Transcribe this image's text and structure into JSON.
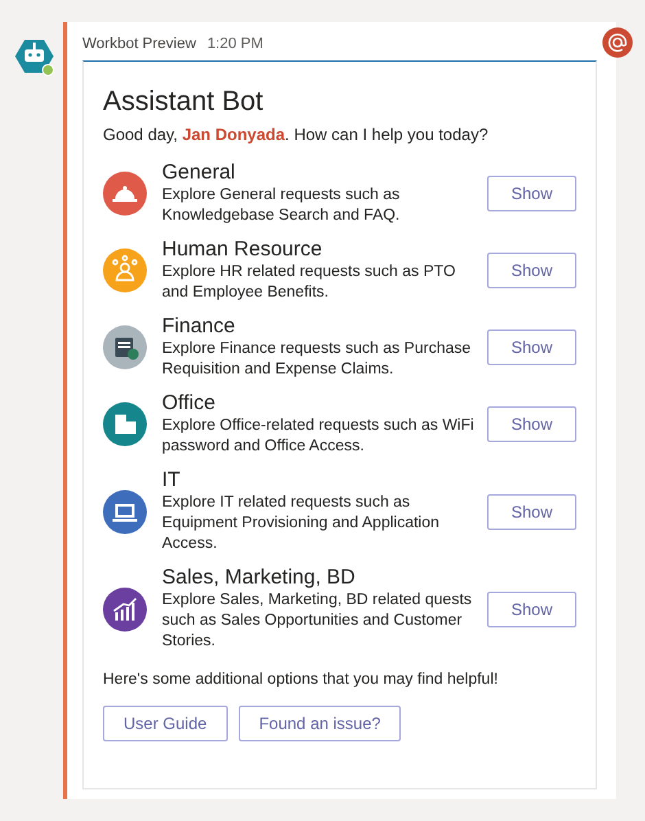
{
  "message": {
    "sender": "Workbot Preview",
    "time": "1:20 PM"
  },
  "card": {
    "title": "Assistant Bot",
    "greeting": "Good day, **Jan Donyada**. How can I help you today?",
    "categories": [
      {
        "title": "General",
        "description": "Explore General requests such as Knowledgebase Search and FAQ.",
        "color": "#e05a4a",
        "button": "Show"
      },
      {
        "title": "Human Resource",
        "description": "Explore HR related requests such as PTO and Employee Benefits.",
        "color": "#f7a21b",
        "button": "Show"
      },
      {
        "title": "Finance",
        "description": "Explore Finance requests such as Purchase Requisition and Expense Claims.",
        "color": "#a9b4bb",
        "button": "Show"
      },
      {
        "title": "Office",
        "description": "Explore Office-related requests such as WiFi password and Office Access.",
        "color": "#14868c",
        "button": "Show"
      },
      {
        "title": "IT",
        "description": "Explore IT related requests such as Equipment Provisioning and Application Access.",
        "color": "#3e6dbb",
        "button": "Show"
      },
      {
        "title": "Sales, Marketing, BD",
        "description": "Explore Sales, Marketing, BD related quests such as Sales Opportunities and Customer Stories.",
        "color": "#6b3fa0",
        "button": "Show"
      }
    ],
    "footer_text": "Here's some additional options that you may find helpful!",
    "actions": [
      "User Guide",
      "Found an issue?"
    ]
  }
}
